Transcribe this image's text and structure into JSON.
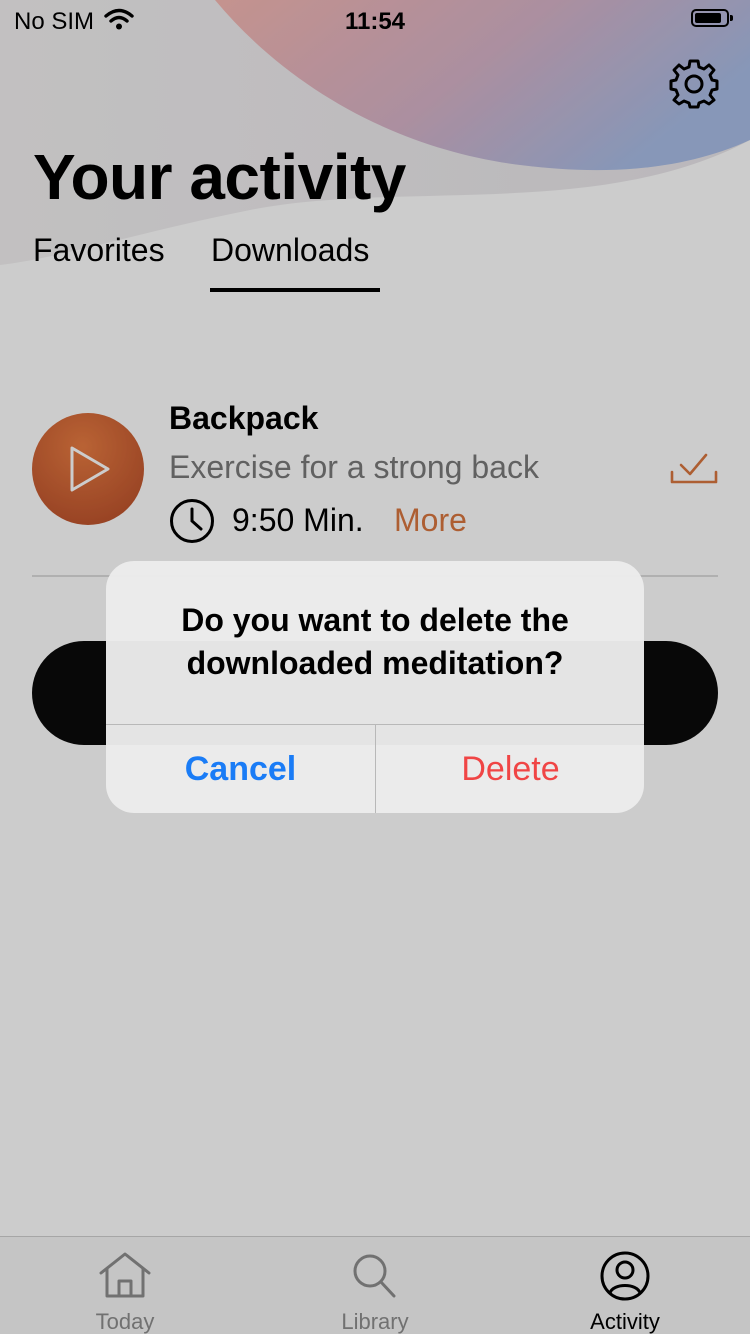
{
  "status_bar": {
    "carrier": "No SIM",
    "time": "11:54"
  },
  "header": {
    "title": "Your activity",
    "settings_icon": "gear-icon"
  },
  "tabs": [
    {
      "label": "Favorites",
      "active": false
    },
    {
      "label": "Downloads",
      "active": true
    }
  ],
  "downloads": [
    {
      "title": "Backpack",
      "subtitle": "Exercise for a strong back",
      "duration": "9:50 Min.",
      "more_label": "More"
    }
  ],
  "alert": {
    "message": "Do you want to delete the downloaded meditation?",
    "cancel_label": "Cancel",
    "delete_label": "Delete"
  },
  "tab_bar": [
    {
      "label": "Today",
      "icon": "home-icon",
      "active": false
    },
    {
      "label": "Library",
      "icon": "search-icon",
      "active": false
    },
    {
      "label": "Activity",
      "icon": "profile-icon",
      "active": true
    }
  ],
  "colors": {
    "accent": "#d9763f",
    "cancel": "#1a7cf6",
    "delete": "#f04545"
  }
}
